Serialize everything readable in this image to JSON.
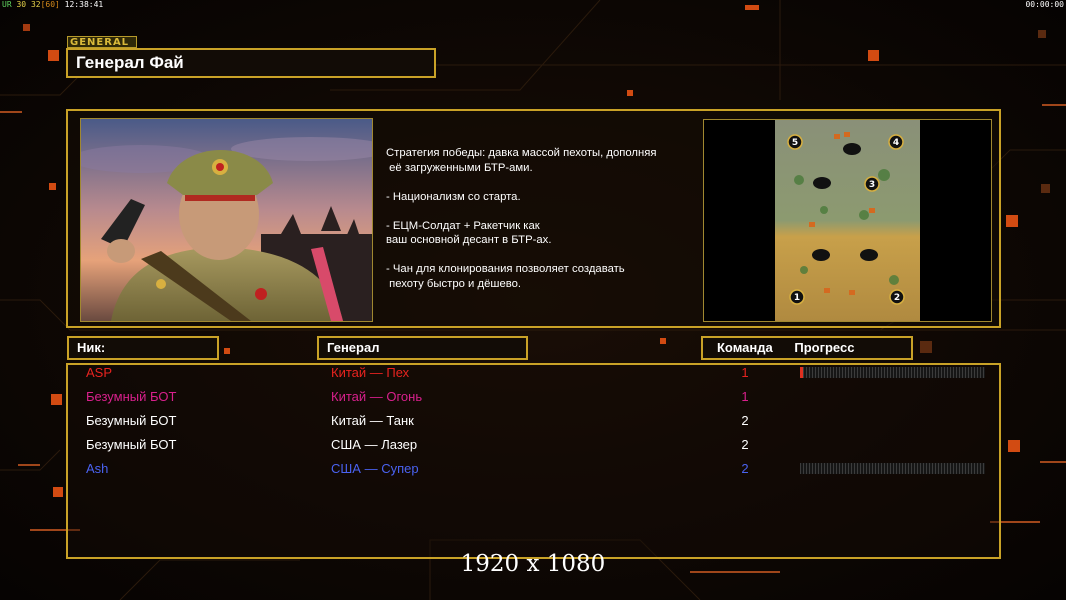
{
  "hud": {
    "left_a": "UR",
    "left_b": "30",
    "left_c": "32",
    "left_d": "[60]",
    "left_time": "12:38:41",
    "right_time": "00:00:00"
  },
  "general_tag": "GENERAL",
  "title": "Генерал Фай",
  "description": [
    "Стратегия победы: давка массой пехоты, дополняя\n её загруженными БТР-ами.",
    "- Национализм со старта.",
    "- ЕЦМ-Солдат + Ракетчик как\nваш основной десант в БТР-ах.",
    "- Чан для клонирования позволяет создавать\n пехоту быстро и дёшево."
  ],
  "map_slots": [
    "5",
    "4",
    "3",
    "1",
    "2"
  ],
  "headers": {
    "nick": "Ник:",
    "general": "Генерал",
    "team": "Команда",
    "progress": "Прогресс"
  },
  "players": [
    {
      "nick": "ASP",
      "general": "Китай — Пех",
      "team": "1",
      "color": "#e8231f",
      "progress": 0.01
    },
    {
      "nick": "Безумный БОТ",
      "general": "Китай — Огонь",
      "team": "1",
      "color": "#d8208c",
      "progress": null
    },
    {
      "nick": "Безумный БОТ",
      "general": "Китай — Танк",
      "team": "2",
      "color": "#ffffff",
      "progress": null
    },
    {
      "nick": "Безумный БОТ",
      "general": "США — Лазер",
      "team": "2",
      "color": "#ffffff",
      "progress": null
    },
    {
      "nick": "Ash",
      "general": "США — Супер",
      "team": "2",
      "color": "#4a62f0",
      "progress": 0.0
    }
  ],
  "resolution_label": "1920 x 1080",
  "colors": {
    "frame": "#c9a227",
    "accent": "#ff6a1a",
    "background": "#0b0704"
  }
}
